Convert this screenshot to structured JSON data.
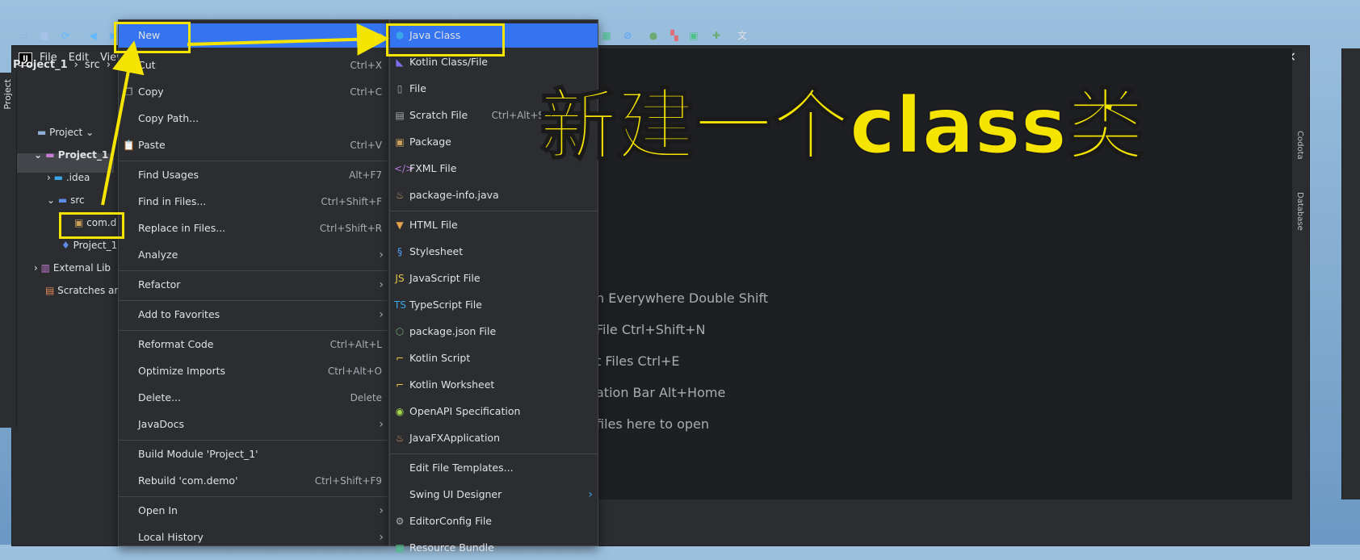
{
  "menubar": {
    "file": "File",
    "edit": "Edit",
    "view": "View"
  },
  "window_buttons": [
    "—",
    "☐",
    "✕"
  ],
  "breadcrumb": {
    "project": "Project_1",
    "src": "src"
  },
  "left_tab": "Project",
  "project_panel": {
    "header": "Project",
    "root": "Project_1",
    "idea": ".idea",
    "src": "src",
    "package": "com.d",
    "file": "Project_1",
    "external": "External Lib",
    "scratches": "Scratches ar"
  },
  "right_tabs": [
    "Codota",
    "Database"
  ],
  "editor_hints": [
    "n Everywhere  Double Shift",
    " File  Ctrl+Shift+N",
    "t Files  Ctrl+E",
    "ation Bar  Alt+Home",
    "files here to open"
  ],
  "context_menu": {
    "new": "New",
    "cut": "Cut",
    "cut_sc": "Ctrl+X",
    "copy": "Copy",
    "copy_sc": "Ctrl+C",
    "copy_path": "Copy Path...",
    "paste": "Paste",
    "paste_sc": "Ctrl+V",
    "find_usages": "Find Usages",
    "find_usages_sc": "Alt+F7",
    "find_in_files": "Find in Files...",
    "find_in_files_sc": "Ctrl+Shift+F",
    "replace_in_files": "Replace in Files...",
    "replace_in_files_sc": "Ctrl+Shift+R",
    "analyze": "Analyze",
    "refactor": "Refactor",
    "add_favorites": "Add to Favorites",
    "reformat": "Reformat Code",
    "reformat_sc": "Ctrl+Alt+L",
    "optimize": "Optimize Imports",
    "optimize_sc": "Ctrl+Alt+O",
    "delete": "Delete...",
    "delete_sc": "Delete",
    "javadocs": "JavaDocs",
    "build_module": "Build Module 'Project_1'",
    "rebuild": "Rebuild 'com.demo'",
    "rebuild_sc": "Ctrl+Shift+F9",
    "open_in": "Open In",
    "local_history": "Local History"
  },
  "new_menu": {
    "java_class": "Java Class",
    "kotlin_class": "Kotlin Class/File",
    "file": "File",
    "scratch": "Scratch File",
    "scratch_sc": "Ctrl+Alt+S",
    "package": "Package",
    "fxml": "FXML File",
    "package_info": "package-info.java",
    "html": "HTML File",
    "stylesheet": "Stylesheet",
    "js": "JavaScript File",
    "ts": "TypeScript File",
    "package_json": "package.json File",
    "kotlin_script": "Kotlin Script",
    "kotlin_worksheet": "Kotlin Worksheet",
    "openapi": "OpenAPI Specification",
    "javafx": "JavaFXApplication",
    "edit_templates": "Edit File Templates...",
    "swing": "Swing UI Designer",
    "editorconfig": "EditorConfig File",
    "resource_bundle": "Resource Bundle"
  },
  "annotation": "新建一个class类",
  "colors": {
    "highlight": "#f5e400",
    "selection": "#3574f0",
    "bg": "#2b2d30"
  }
}
